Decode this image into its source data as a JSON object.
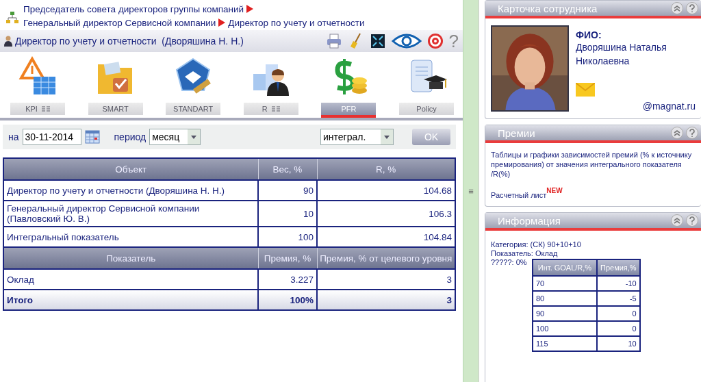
{
  "breadcrumb": [
    {
      "text": "Председатель совета директоров группы компаний"
    },
    {
      "text": "Генеральный директор Сервисной компании"
    },
    {
      "text": "Директор по учету и отчетности"
    }
  ],
  "header": {
    "title": "Директор по учету и отчетности  (Дворяшина Н. Н.)",
    "help": "?"
  },
  "modules": [
    {
      "kind": "kpi",
      "label": "KPI",
      "grid": true,
      "selected": false
    },
    {
      "kind": "smart",
      "label": "SMART",
      "grid": false,
      "selected": false
    },
    {
      "kind": "standart",
      "label": "STANDART",
      "grid": false,
      "selected": false
    },
    {
      "kind": "r",
      "label": "R",
      "grid": true,
      "selected": false
    },
    {
      "kind": "pfr",
      "label": "PFR",
      "grid": false,
      "selected": true
    },
    {
      "kind": "policy",
      "label": "Policy",
      "grid": false,
      "selected": false
    }
  ],
  "filters": {
    "date_label": "на",
    "date": "30-11-2014",
    "period_label": "период",
    "period": "месяц",
    "mode": "интеграл.",
    "ok": "OK"
  },
  "table": {
    "sections": [
      {
        "columns": [
          "Объект",
          "Вес, %",
          "R, %"
        ],
        "rows": [
          {
            "cells": [
              "Директор по учету и отчетности (Дворяшина Н. Н.)",
              "90",
              "104.68"
            ],
            "total": false
          },
          {
            "cells": [
              "Генеральный директор Сервисной компании (Павловский Ю. В.)",
              "10",
              "106.3"
            ],
            "total": false
          },
          {
            "cells": [
              "Интегральный показатель",
              "100",
              "104.84"
            ],
            "total": false
          }
        ]
      },
      {
        "columns": [
          "Показатель",
          "Премия, %",
          "Премия, % от целевого уровня"
        ],
        "rows": [
          {
            "cells": [
              "Оклад",
              "3.227",
              "3"
            ],
            "total": false
          },
          {
            "cells": [
              "Итого",
              "100%",
              "3"
            ],
            "total": true
          }
        ]
      }
    ]
  },
  "splitter": {
    "glyph": "≡"
  },
  "employee_card": {
    "title": "Карточка сотрудника",
    "fio_label": "ФИО:",
    "name": "Дворяшина Наталья Николаевна",
    "email": "@magnat.ru"
  },
  "bonus_card": {
    "title": "Премии",
    "text": "Таблицы и графики зависимостей премий (% к источнику премирования) от значения интегрального показателя /R(%)",
    "link": "Расчетный лист",
    "badge": "NEW"
  },
  "info_card": {
    "title": "Информация",
    "lines": [
      "Категория: (СК) 90+10+10",
      "Показатель: Оклад",
      "?????: 0%"
    ],
    "columns": [
      "Инт. GOAL/R,%",
      "Премия,%"
    ],
    "rows": [
      [
        "70",
        "-10"
      ],
      [
        "80",
        "-5"
      ],
      [
        "90",
        "0"
      ],
      [
        "100",
        "0"
      ],
      [
        "115",
        "10"
      ]
    ]
  }
}
